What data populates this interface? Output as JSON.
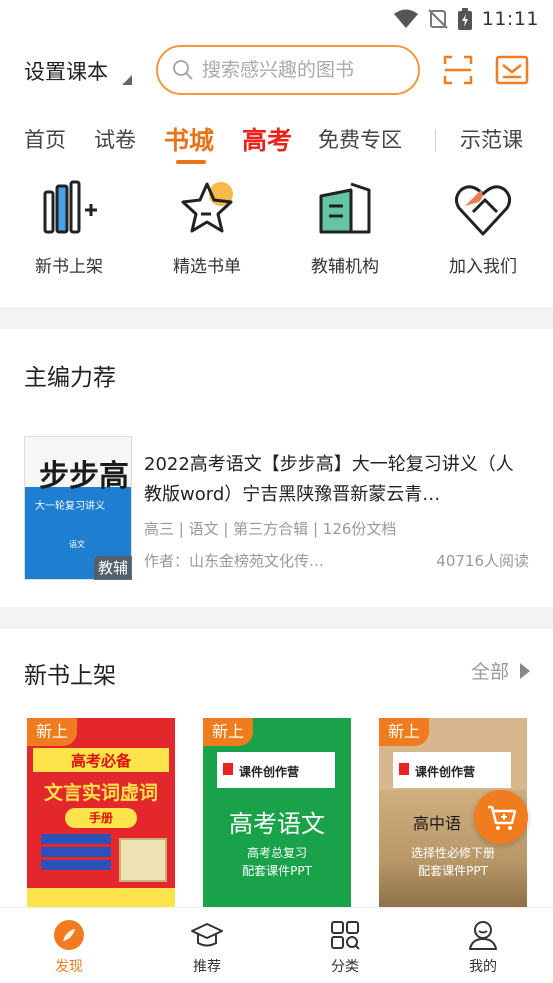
{
  "status_bar": {
    "time": "11:11"
  },
  "header": {
    "course_select_label": "设置课本",
    "search_placeholder": "搜索感兴趣的图书"
  },
  "tabs": [
    {
      "label": "首页"
    },
    {
      "label": "试卷"
    },
    {
      "label": "书城",
      "active": true
    },
    {
      "label": "高考"
    },
    {
      "label": "免费专区"
    },
    {
      "label": "示范课"
    }
  ],
  "quick_entries": [
    {
      "label": "新书上架",
      "icon": "new-books-icon"
    },
    {
      "label": "精选书单",
      "icon": "star-list-icon"
    },
    {
      "label": "教辅机构",
      "icon": "building-icon"
    },
    {
      "label": "加入我们",
      "icon": "handshake-heart-icon"
    }
  ],
  "featured": {
    "section_title": "主编力荐",
    "book": {
      "cover_big_text": "步步高",
      "cover_title": "大一轮复习讲义",
      "cover_subject": "语文",
      "badge": "教辅",
      "title": "2022高考语文【步步高】大一轮复习讲义（人教版word）宁吉黑陕豫晋新蒙云青…",
      "meta": "高三 | 语文 | 第三方合辑 | 126份文档",
      "author": "作者：山东金榜苑文化传…",
      "reads": "40716人阅读"
    }
  },
  "new_shelf": {
    "section_title": "新书上架",
    "see_all_label": "全部",
    "tag_label": "新上",
    "books": [
      {
        "line1": "高考必备",
        "line2": "文言实词虚词",
        "line3": "手册"
      },
      {
        "brand": "课件创作营",
        "title": "高考语文",
        "sub1": "高考总复习",
        "sub2": "配套课件PPT"
      },
      {
        "brand": "课件创作营",
        "title": "高中语",
        "sub1": "选择性必修下册",
        "sub2": "配套课件PPT"
      }
    ]
  },
  "bottom_nav": [
    {
      "label": "发现",
      "icon": "discover-icon",
      "active": true
    },
    {
      "label": "推荐",
      "icon": "graduation-cap-icon"
    },
    {
      "label": "分类",
      "icon": "category-grid-icon"
    },
    {
      "label": "我的",
      "icon": "profile-icon"
    }
  ],
  "colors": {
    "accent": "#f07c1f",
    "hot": "#e8231b",
    "muted": "#999999"
  }
}
